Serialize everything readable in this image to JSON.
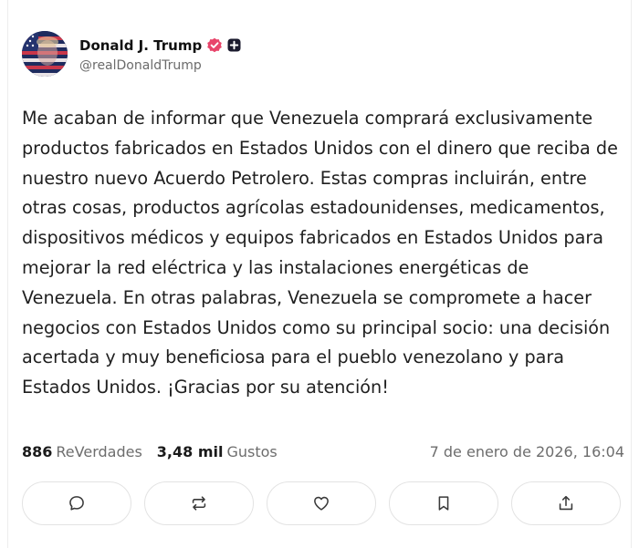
{
  "author": {
    "display_name": "Donald J. Trump",
    "handle": "@realDonaldTrump",
    "avatar_icon": "flag-portrait-avatar",
    "verified_icon": "verified-badge-icon",
    "badge_icon": "plus-badge-icon",
    "verified_color": "#e8456b"
  },
  "post": {
    "text": "Me acaban de informar que Venezuela comprará exclusivamente productos fabricados en Estados Unidos con el dinero que reciba de nuestro nuevo Acuerdo Petrolero. Estas compras incluirán, entre otras cosas, productos agrícolas estadounidenses, medicamentos, dispositivos médicos y equipos fabricados en Estados Unidos para mejorar la red eléctrica y las instalaciones energéticas de Venezuela. En otras palabras, Venezuela se compromete a hacer negocios con Estados Unidos como su principal socio: una decisión acertada y muy beneficiosa para el pueblo venezolano y para Estados Unidos. ¡Gracias por su atención!"
  },
  "stats": {
    "reposts_count": "886",
    "reposts_label": "ReVerdades",
    "likes_count": "3,48 mil",
    "likes_label": "Gustos",
    "date": "7 de enero de 2026, 16:04"
  },
  "actions": [
    {
      "name": "reply",
      "icon": "comment-icon"
    },
    {
      "name": "repost",
      "icon": "repost-icon"
    },
    {
      "name": "like",
      "icon": "heart-icon"
    },
    {
      "name": "bookmark",
      "icon": "bookmark-icon"
    },
    {
      "name": "share",
      "icon": "share-icon"
    }
  ]
}
